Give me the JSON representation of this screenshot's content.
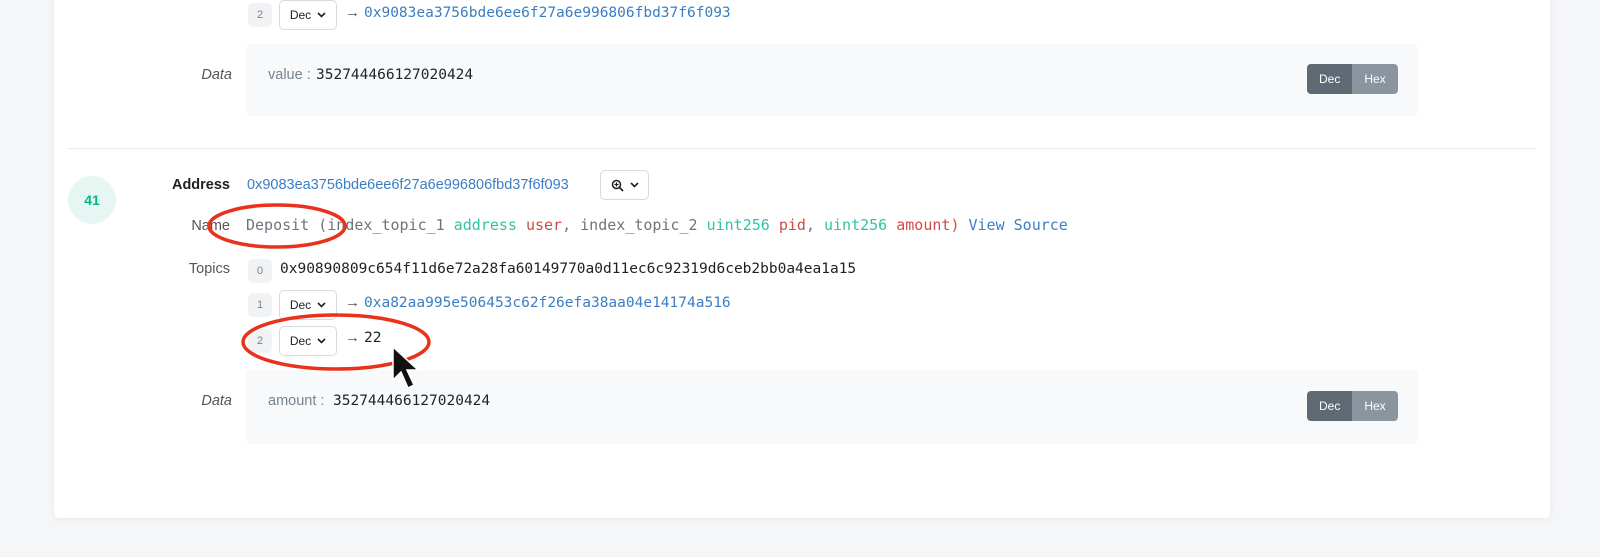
{
  "prev_log": {
    "topic2": {
      "index": "2",
      "format": "Dec",
      "arrow": "→",
      "value": "0x9083ea3756bde6ee6f27a6e996806fbd37f6f093"
    },
    "data_label": "Data",
    "data_key": "value :",
    "data_value": "352744466127020424",
    "dec_label": "Dec",
    "hex_label": "Hex"
  },
  "log": {
    "number": "41",
    "address_label": "Address",
    "address": "0x9083ea3756bde6ee6f27a6e996806fbd37f6f093",
    "name_label": "Name",
    "signature": {
      "event": "Deposit",
      "open": " (",
      "p1_name": "index_topic_1",
      "p1_type": "address",
      "p1_var": "user",
      "sep1": ", ",
      "p2_name": "index_topic_2",
      "p2_type": "uint256",
      "p2_var": "pid",
      "sep2": ", ",
      "p3_type": "uint256",
      "p3_var": "amount",
      "close": ")",
      "view_source": "View Source"
    },
    "topics_label": "Topics",
    "topics": [
      {
        "index": "0",
        "value": "0x90890809c654f11d6e72a28fa60149770a0d11ec6c92319d6ceb2bb0a4ea1a15"
      },
      {
        "index": "1",
        "format": "Dec",
        "arrow": "→",
        "value": "0xa82aa995e506453c62f26efa38aa04e14174a516"
      },
      {
        "index": "2",
        "format": "Dec",
        "arrow": "→",
        "value": "22"
      }
    ],
    "data_label": "Data",
    "data_key": "amount :",
    "data_value": "352744466127020424",
    "dec_label": "Dec",
    "hex_label": "Hex"
  },
  "colors": {
    "link": "#3b7ec4",
    "type": "#2ec4a6",
    "var": "#d04a4a",
    "highlight_circle": "#e8321c",
    "log_number": "#00b88a"
  },
  "icons": {
    "zoom": "zoom-in-icon",
    "chevron": "chevron-down-icon",
    "cursor": "mouse-pointer-icon"
  }
}
